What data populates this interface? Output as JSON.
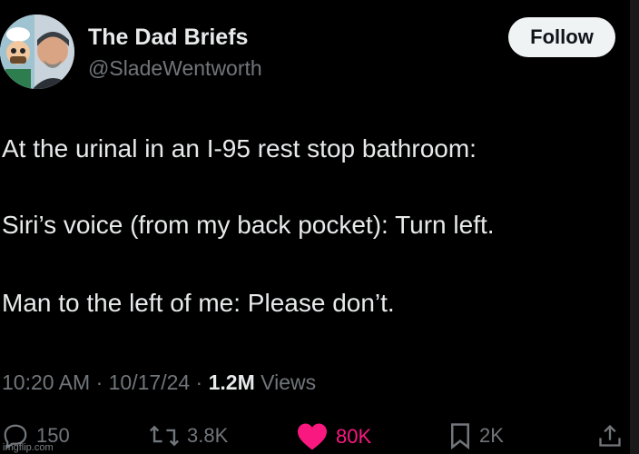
{
  "author": {
    "name": "The Dad Briefs",
    "handle": "@SladeWentworth"
  },
  "follow_label": "Follow",
  "tweet": {
    "lines": [
      "At the urinal in an I-95 rest stop bathroom:",
      "Siri’s voice (from my back pocket): Turn left.",
      "Man to the left of me: Please don’t."
    ]
  },
  "meta": {
    "time": "10:20 AM",
    "sep1": " · ",
    "date": "10/17/24",
    "sep2": " · ",
    "views_count": "1.2M",
    "views_label": " Views"
  },
  "actions": {
    "replies": "150",
    "reposts": "3.8K",
    "likes": "80K",
    "bookmarks": "2K"
  },
  "icons": {
    "reply": "reply-icon",
    "repost": "repost-icon",
    "like": "heart-icon",
    "bookmark": "bookmark-icon",
    "share": "share-icon"
  },
  "colors": {
    "background": "#000000",
    "text": "#e7e9ea",
    "muted": "#71767b",
    "like": "#f91880",
    "follow_bg": "#eff3f4"
  },
  "watermark": "imgflip.com"
}
